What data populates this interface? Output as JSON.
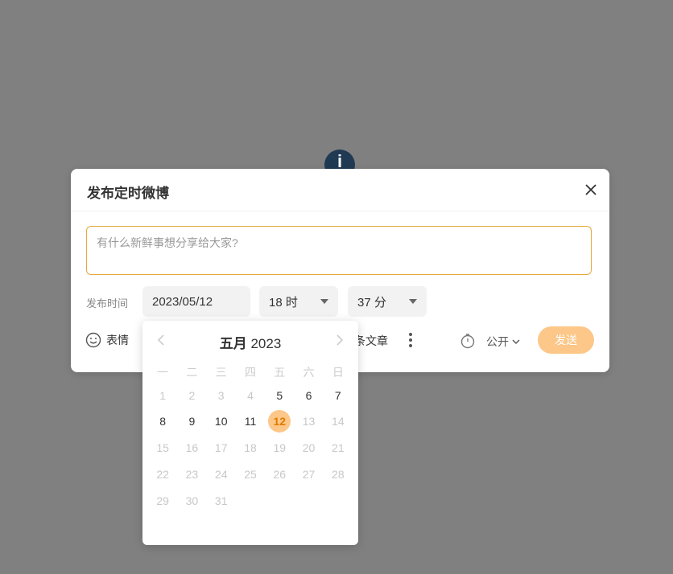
{
  "dialog": {
    "title": "发布定时微博",
    "compose_placeholder": "有什么新鲜事想分享给大家?",
    "time_label": "发布时间",
    "date_value": "2023/05/12",
    "hour_value": "18 时",
    "minute_value": "37 分",
    "emoji_label": "表情",
    "article_label": "条文章",
    "visibility_label": "公开",
    "send_label": "发送"
  },
  "calendar": {
    "month_label": "五月",
    "year_label": "2023",
    "weekdays": [
      "一",
      "二",
      "三",
      "四",
      "五",
      "六",
      "日"
    ],
    "weeks": [
      [
        "1",
        "2",
        "3",
        "4",
        "5",
        "6",
        "7"
      ],
      [
        "8",
        "9",
        "10",
        "11",
        "12",
        "13",
        "14"
      ],
      [
        "15",
        "16",
        "17",
        "18",
        "19",
        "20",
        "21"
      ],
      [
        "22",
        "23",
        "24",
        "25",
        "26",
        "27",
        "28"
      ],
      [
        "29",
        "30",
        "31",
        "",
        "",
        "",
        ""
      ]
    ],
    "enabled_days": [
      "5",
      "6",
      "7",
      "8",
      "9",
      "10",
      "11",
      "12"
    ],
    "selected_day": "12"
  },
  "colors": {
    "accent": "#fcc788",
    "accent_text": "#e07b00",
    "input_border": "#e5a93c",
    "overlay": "#808080"
  },
  "icons": {
    "info": "info-icon",
    "close": "close-icon",
    "emoji": "smiley-icon",
    "more": "more-vertical-icon",
    "timer": "timer-icon",
    "chevron_down": "chevron-down-icon",
    "prev": "chevron-left-icon",
    "next": "chevron-right-icon"
  }
}
